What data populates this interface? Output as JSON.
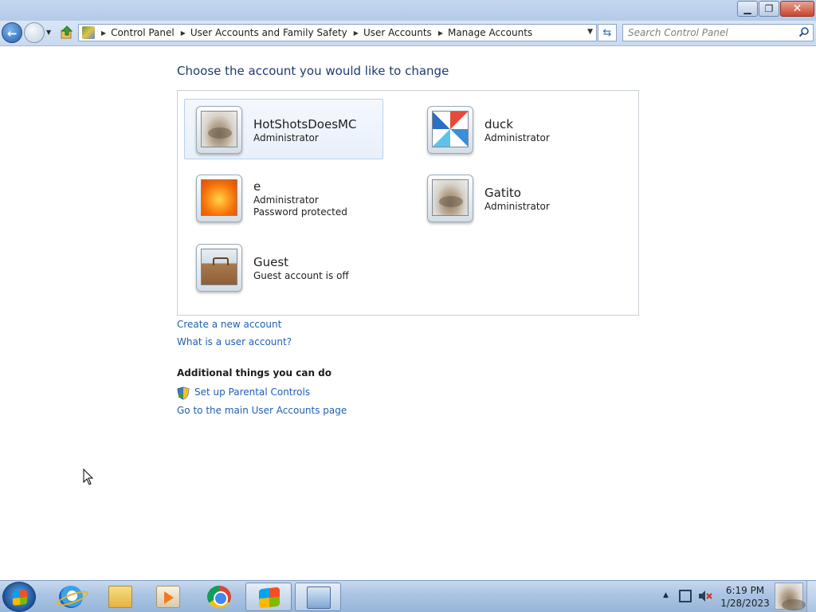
{
  "window": {
    "minimize_glyph": "▁",
    "maximize_glyph": "❐",
    "close_glyph": "✕"
  },
  "address_bar": {
    "breadcrumbs": [
      "Control Panel",
      "User Accounts and Family Safety",
      "User Accounts",
      "Manage Accounts"
    ],
    "search_placeholder": "Search Control Panel"
  },
  "main": {
    "heading": "Choose the account you would like to change",
    "accounts": [
      {
        "name": "HotShotsDoesMC",
        "role": "Administrator",
        "extra": "",
        "picture": "cat"
      },
      {
        "name": "duck",
        "role": "Administrator",
        "extra": "",
        "picture": "pinwheel"
      },
      {
        "name": "e",
        "role": "Administrator",
        "extra": "Password protected",
        "picture": "flower"
      },
      {
        "name": "Gatito",
        "role": "Administrator",
        "extra": "",
        "picture": "cat"
      },
      {
        "name": "Guest",
        "role": "Guest account is off",
        "extra": "",
        "picture": "suitcase"
      }
    ],
    "links": {
      "create_account": "Create a new account",
      "what_is_account": "What is a user account?"
    },
    "additional": {
      "heading": "Additional things you can do",
      "parental_controls": "Set up Parental Controls",
      "main_page": "Go to the main User Accounts page"
    }
  },
  "taskbar": {
    "items": [
      "start-button",
      "internet-explorer",
      "windows-explorer",
      "windows-media-player",
      "google-chrome",
      "windows-flag-app",
      "control-panel"
    ],
    "clock": {
      "time": "6:19 PM",
      "date": "1/28/2023"
    }
  }
}
